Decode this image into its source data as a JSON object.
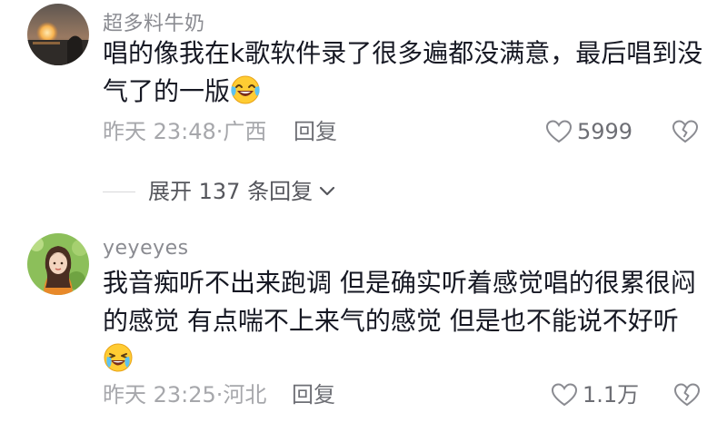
{
  "comments": [
    {
      "username": "超多料牛奶",
      "text": "唱的像我在k歌软件录了很多遍都没满意，最后唱到没气了的一版",
      "emoji": "laughing-crying-emoji",
      "time_location": "昨天 23:48·广西",
      "reply_label": "回复",
      "like_count": "5999",
      "expand_replies_label": "展开 137 条回复"
    },
    {
      "username": "yeyeyes",
      "text": "我音痴听不出来跑调 但是确实听着感觉唱的很累很闷的感觉 有点喘不上来气的感觉 但是也不能说不好听",
      "emoji": "crying-laughing-emoji",
      "time_location": "昨天 23:25·河北",
      "reply_label": "回复",
      "like_count": "1.1万"
    }
  ],
  "icons": {
    "like": "heart-outline-icon",
    "dislike": "broken-heart-outline-icon",
    "expand": "chevron-down-icon"
  },
  "colors": {
    "username": "#8a8b91",
    "text": "#161823",
    "meta": "#a6a7ab",
    "action": "#6e6f75"
  }
}
